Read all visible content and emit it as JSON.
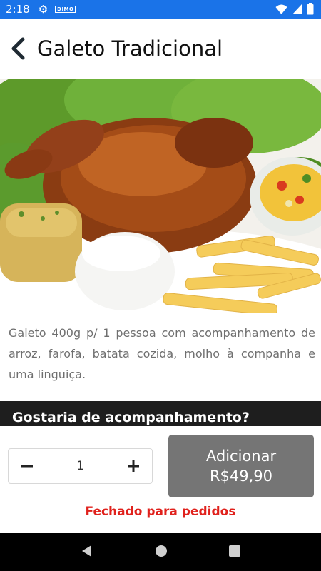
{
  "status_bar": {
    "time": "2:18",
    "mini_label": "DIMO"
  },
  "header": {
    "title": "Galeto Tradicional"
  },
  "product": {
    "image_alt": "Galeto assado com acompanhamentos",
    "description": "Galeto 400g p/ 1 pessoa com acompanhamento de arroz, farofa, batata cozida, molho à companha e uma linguiça."
  },
  "section": {
    "title": "Gostaria de acompanhamento?"
  },
  "order": {
    "quantity": "1",
    "add_label": "Adicionar",
    "price": "R$49,90",
    "closed_message": "Fechado para pedidos"
  },
  "colors": {
    "status_bar": "#1a73e8",
    "add_button": "#757575",
    "closed_text": "#e0211c",
    "section_bar": "#1e1e1e"
  },
  "icons": {
    "back": "chevron-left-icon",
    "minus": "minus-icon",
    "plus": "plus-icon",
    "nav_back": "triangle-back-icon",
    "nav_home": "circle-home-icon",
    "nav_recents": "square-recents-icon"
  }
}
